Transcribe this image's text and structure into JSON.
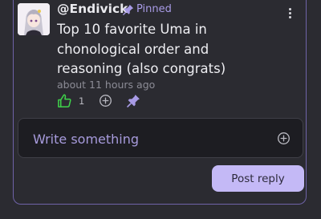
{
  "post": {
    "username": "@Endivick",
    "pinned_label": "Pinned",
    "body": "Top 10 favorite Uma in chonological order and reasoning (also congrats)",
    "timestamp": "about 11 hours ago",
    "like_count": "1"
  },
  "icons": {
    "pin": "pin-icon",
    "more": "more-vertical-icon",
    "like": "thumbs-up-icon",
    "react": "add-circle-icon",
    "add": "add-circle-icon"
  },
  "composer": {
    "placeholder": "Write something",
    "value": ""
  },
  "reply_button": {
    "label": "Post reply"
  },
  "colors": {
    "accent": "#a89be6",
    "like_green": "#3fd34a",
    "button_bg": "#c4b9f6",
    "background": "#2b2b31"
  }
}
